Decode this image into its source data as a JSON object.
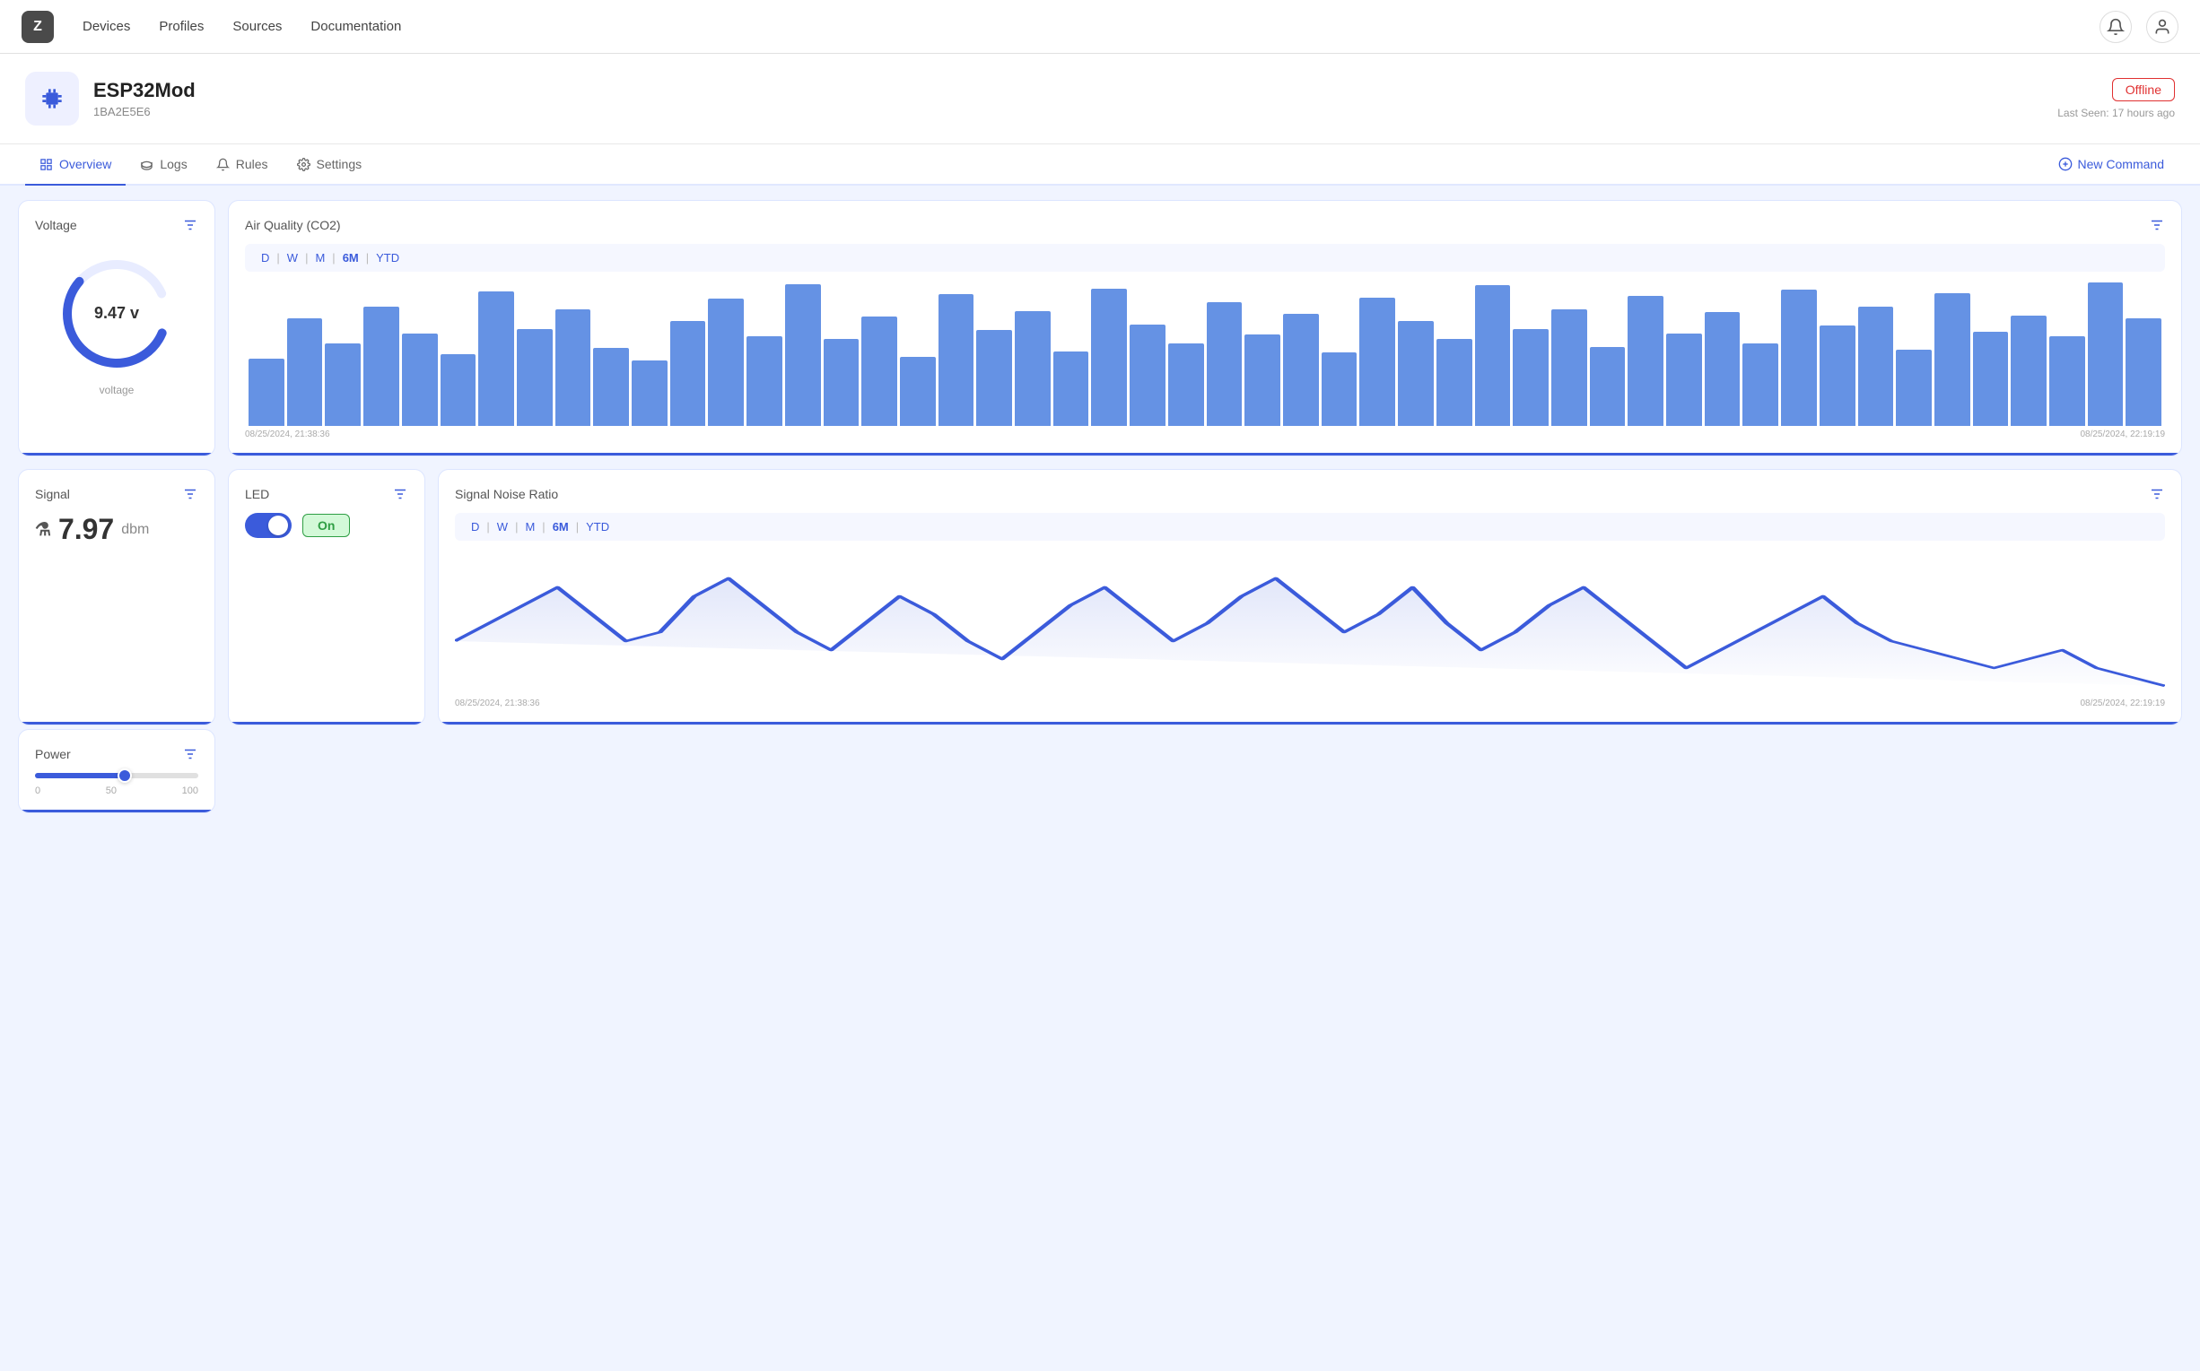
{
  "nav": {
    "logo": "Z",
    "links": [
      "Devices",
      "Profiles",
      "Sources",
      "Documentation"
    ]
  },
  "device": {
    "name": "ESP32Mod",
    "id": "1BA2E5E6",
    "status": "Offline",
    "last_seen": "Last Seen: 17 hours ago"
  },
  "tabs": {
    "items": [
      "Overview",
      "Logs",
      "Rules",
      "Settings"
    ],
    "active": "Overview",
    "new_command": "New Command"
  },
  "voltage": {
    "title": "Voltage",
    "value": "9.47 v",
    "label": "voltage",
    "percent": 63
  },
  "air_quality": {
    "title": "Air Quality (CO2)",
    "time_filters": [
      "D",
      "W",
      "M",
      "6M",
      "YTD"
    ],
    "active_filter": "6M",
    "date_start": "08/25/2024, 21:38:36",
    "date_end": "08/25/2024, 22:19:19",
    "bars": [
      45,
      72,
      55,
      80,
      62,
      48,
      90,
      65,
      78,
      52,
      44,
      70,
      85,
      60,
      95,
      58,
      73,
      46,
      88,
      64,
      77,
      50,
      92,
      68,
      55,
      83,
      61,
      75,
      49,
      86,
      70,
      58,
      94,
      65,
      78,
      53,
      87,
      62,
      76,
      55,
      91,
      67,
      80,
      51,
      89,
      63,
      74,
      60,
      96,
      72
    ]
  },
  "signal": {
    "title": "Signal",
    "value": "7.97",
    "unit": "dbm"
  },
  "led": {
    "title": "LED",
    "state": "On"
  },
  "power": {
    "title": "Power",
    "min": "0",
    "mid": "50",
    "max": "100",
    "value": 55
  },
  "signal_noise": {
    "title": "Signal Noise Ratio",
    "time_filters": [
      "D",
      "W",
      "M",
      "6M",
      "YTD"
    ],
    "active_filter": "6M",
    "date_start": "08/25/2024, 21:38:36",
    "date_end": "08/25/2024, 22:19:19"
  },
  "icons": {
    "filter": "⊞",
    "bell": "🔔",
    "user": "👤",
    "overview": "⊡",
    "logs": "⊟",
    "rules": "🔔",
    "settings": "⚙",
    "new_command": "⊕",
    "chip": "⬛",
    "flask": "⚗"
  }
}
